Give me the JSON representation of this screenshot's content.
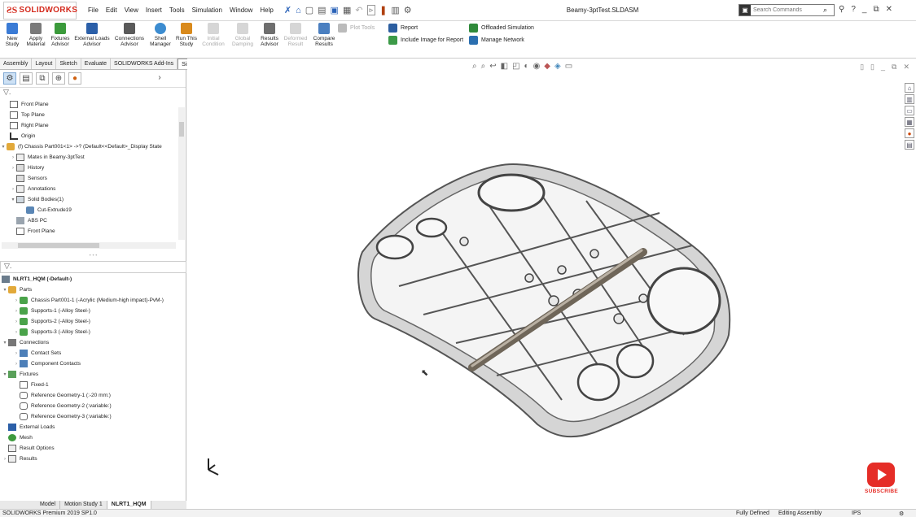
{
  "app": {
    "logo_text": "SOLIDWORKS",
    "document_title": "Beamy-3ptTest.SLDASM"
  },
  "menu": [
    "File",
    "Edit",
    "View",
    "Insert",
    "Tools",
    "Simulation",
    "Window",
    "Help"
  ],
  "search": {
    "placeholder": "Search Commands"
  },
  "ribbon": {
    "new_study": "New Study",
    "apply_material": "Apply Material",
    "fixtures_advisor": "Fixtures Advisor",
    "external_loads_advisor": "External Loads Advisor",
    "connections_advisor": "Connections Advisor",
    "shell_manager": "Shell Manager",
    "run_this_study": "Run This Study",
    "initial_condition": "Initial Condition",
    "global_damping": "Global Damping",
    "results_advisor": "Results Advisor",
    "deformed_result": "Deformed Result",
    "compare_results": "Compare Results",
    "plot_tools": "Plot Tools",
    "report": "Report",
    "include_image": "Include Image for Report",
    "offloaded_simulation": "Offloaded Simulation",
    "manage_network": "Manage Network"
  },
  "command_tabs": [
    "Assembly",
    "Layout",
    "Sketch",
    "Evaluate",
    "SOLIDWORKS Add-Ins",
    "Simulation"
  ],
  "feature_tree": [
    "Front Plane",
    "Top Plane",
    "Right Plane",
    "Origin",
    "(f) Chassis Part001<1> ->? (Default<<Default>_Display State",
    "Mates in Beamy-3ptTest",
    "History",
    "Sensors",
    "Annotations",
    "Solid Bodies(1)",
    "Cut-Extrude19",
    "ABS PC",
    "Front Plane"
  ],
  "study_tree": [
    "NLRT1_HQM (-Default-)",
    "Parts",
    "Chassis Part001-1 (-Acrylic (Medium-high impact)-PvM-)",
    "Supports-1 (-Alloy Steel-)",
    "Supports-2 (-Alloy Steel-)",
    "Supports-3 (-Alloy Steel-)",
    "Connections",
    "Contact Sets",
    "Component Contacts",
    "Fixtures",
    "Fixed-1",
    "Reference Geometry-1 (:-20 mm:)",
    "Reference Geometry-2 (:variable:)",
    "Reference Geometry-3 (:variable:)",
    "External Loads",
    "Mesh",
    "Result Options",
    "Results"
  ],
  "bottom_tabs": [
    "Model",
    "Motion Study 1",
    "NLRT1_HQM"
  ],
  "status": {
    "left": "SOLIDWORKS Premium 2019 SP1.0",
    "state": "Fully Defined",
    "mode": "Editing Assembly",
    "units": "IPS"
  },
  "subscribe_label": "SUBSCRIBE",
  "colors": {
    "brand": "#d42b1e",
    "youtube": "#e52d27"
  }
}
